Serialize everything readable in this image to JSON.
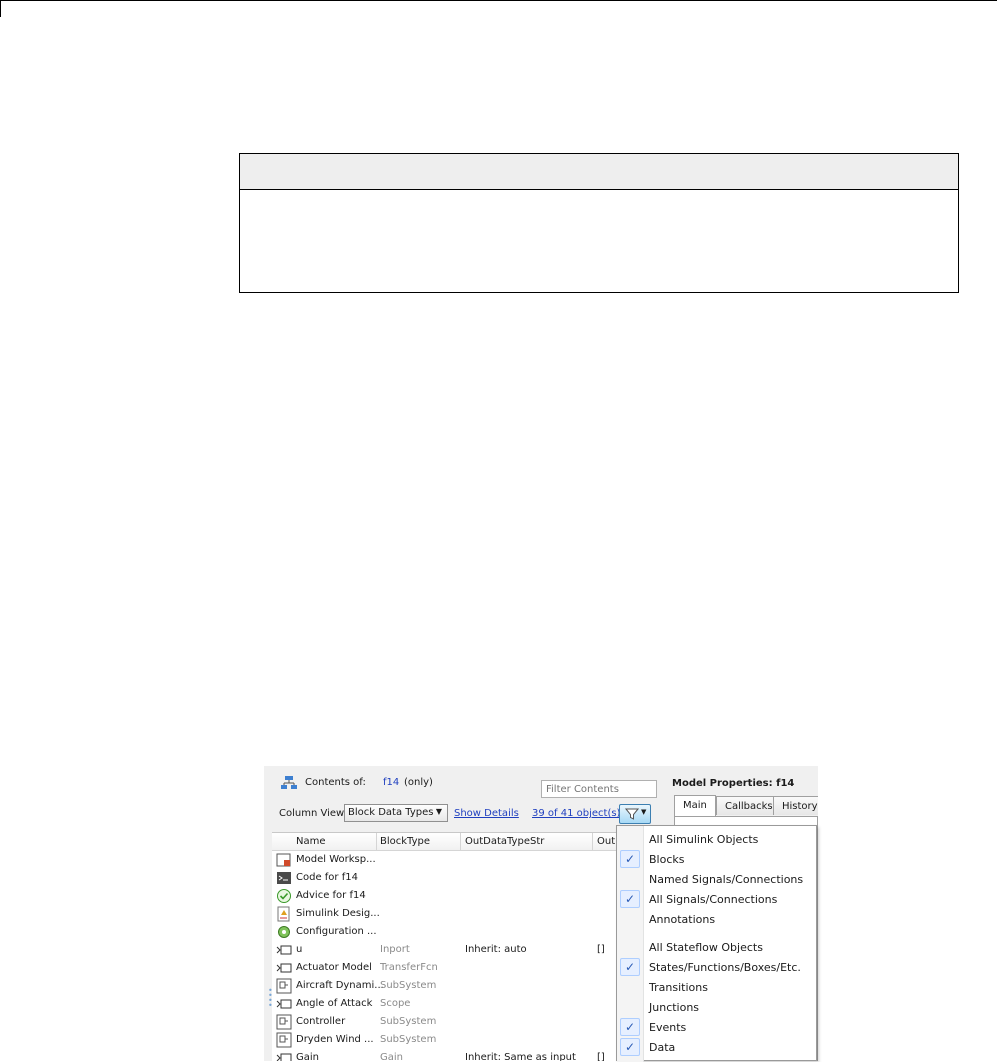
{
  "explorer": {
    "contents_label": "Contents of:",
    "contents_model": "f14",
    "contents_scope": "(only)",
    "filter_placeholder": "Filter Contents",
    "column_view_label": "Column View:",
    "column_view_value": "Block Data Types",
    "show_details": "Show Details",
    "object_count": "39 of 41 object(s)",
    "columns": [
      "Name",
      "BlockType",
      "OutDataTypeStr",
      "Out"
    ],
    "rows": [
      {
        "name": "Model Worksp...",
        "type": "",
        "dtype": "",
        "out": "",
        "icon": "model-workspace-icon"
      },
      {
        "name": "Code for f14",
        "type": "",
        "dtype": "",
        "out": "",
        "icon": "code-icon"
      },
      {
        "name": "Advice for f14",
        "type": "",
        "dtype": "",
        "out": "",
        "icon": "advisor-check-icon"
      },
      {
        "name": "Simulink Desig...",
        "type": "",
        "dtype": "",
        "out": "",
        "icon": "design-verifier-icon"
      },
      {
        "name": "Configuration ...",
        "type": "",
        "dtype": "",
        "out": "",
        "icon": "configuration-gear-icon"
      },
      {
        "name": "u",
        "type": "Inport",
        "dtype": "Inherit: auto",
        "out": "[]",
        "icon": "inport-block-icon"
      },
      {
        "name": "Actuator Model",
        "type": "TransferFcn",
        "dtype": "",
        "out": "",
        "icon": "transfer-fcn-block-icon"
      },
      {
        "name": "Aircraft Dynami...",
        "type": "SubSystem",
        "dtype": "",
        "out": "",
        "icon": "subsystem-block-icon"
      },
      {
        "name": "Angle of  Attack",
        "type": "Scope",
        "dtype": "",
        "out": "",
        "icon": "scope-block-icon"
      },
      {
        "name": "Controller",
        "type": "SubSystem",
        "dtype": "",
        "out": "",
        "icon": "subsystem-block-icon"
      },
      {
        "name": "Dryden Wind ...",
        "type": "SubSystem",
        "dtype": "",
        "out": "",
        "icon": "subsystem-block-icon"
      },
      {
        "name": "Gain",
        "type": "Gain",
        "dtype": "Inherit: Same as input",
        "out": "[]",
        "icon": "gain-block-icon"
      }
    ]
  },
  "properties": {
    "title": "Model Properties: f14",
    "tabs": [
      "Main",
      "Callbacks",
      "History"
    ]
  },
  "filter_menu": {
    "items": [
      {
        "label": "All Simulink Objects",
        "checked": false
      },
      {
        "label": "Blocks",
        "checked": true
      },
      {
        "label": "Named Signals/Connections",
        "checked": false
      },
      {
        "label": "All Signals/Connections",
        "checked": true
      },
      {
        "label": "Annotations",
        "checked": false
      },
      {
        "label": "All Stateflow Objects",
        "checked": false
      },
      {
        "label": "States/Functions/Boxes/Etc.",
        "checked": true
      },
      {
        "label": "Transitions",
        "checked": false
      },
      {
        "label": "Junctions",
        "checked": false
      },
      {
        "label": "Events",
        "checked": true
      },
      {
        "label": "Data",
        "checked": true
      }
    ],
    "check_glyph": "✓"
  },
  "colors": {
    "link": "#1f3fbf",
    "check_bg": "#e6efff",
    "check_border": "#aeceff"
  }
}
